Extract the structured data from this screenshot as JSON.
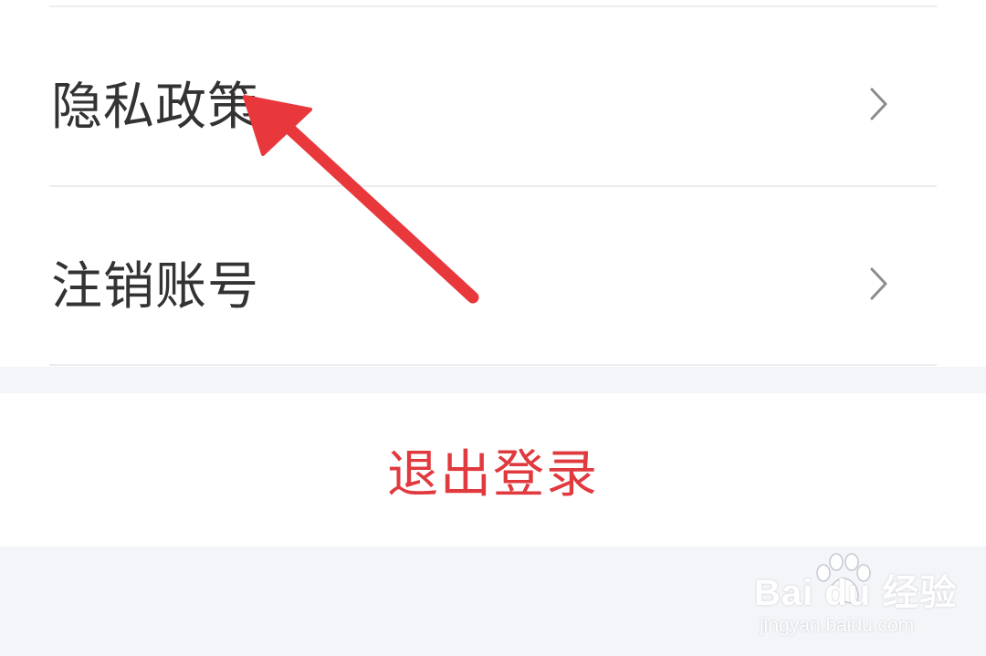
{
  "settings_menu": {
    "items": [
      {
        "label": "隐私政策",
        "icon": "chevron-right-icon"
      },
      {
        "label": "注销账号",
        "icon": "chevron-right-icon"
      }
    ]
  },
  "logout": {
    "label": "退出登录",
    "color": "#e0393e"
  },
  "annotation": {
    "type": "arrow",
    "color": "#e8383c",
    "points_to": "隐私政策"
  },
  "watermark": {
    "brand": "Bai du 经验",
    "url": "jingyan.baidu.com"
  },
  "colors": {
    "background": "#f4f5f9",
    "card": "#ffffff",
    "text": "#333333",
    "chevron": "#8c8c8c",
    "divider": "#ececf0"
  }
}
